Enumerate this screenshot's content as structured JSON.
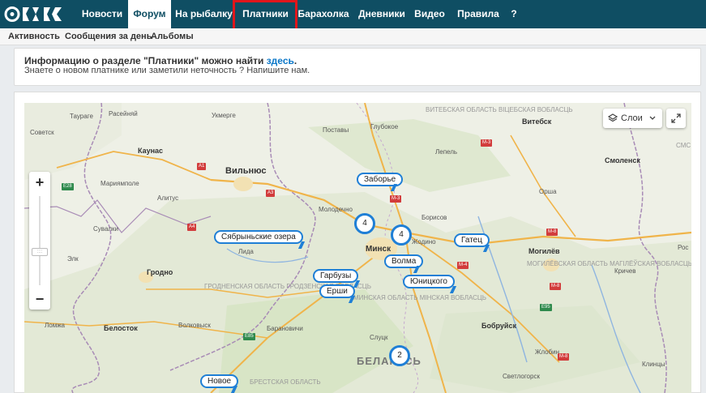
{
  "logo": {
    "name": "site-logo"
  },
  "nav": {
    "items": [
      "Новости",
      "Форум",
      "На рыбалку",
      "Платники",
      "Барахолка",
      "Дневники",
      "Видео",
      "Правила",
      "?"
    ]
  },
  "subnav": {
    "items": [
      "Активность",
      "Сообщения за день",
      "Альбомы"
    ]
  },
  "info": {
    "title_prefix": "Информацию о разделе \"Платники\" можно найти",
    "link": "здесь",
    "title_suffix": ".",
    "subtitle": "Знаете о новом платнике или заметили неточность ? Напишите нам."
  },
  "map": {
    "layers_label": "Слои",
    "zoom_in": "+",
    "zoom_out": "−",
    "places": [
      "Таураге",
      "Расейняй",
      "Укмерге",
      "Поставы",
      "Глубокое",
      "Витебск",
      "Советск",
      "Каунас",
      "Вильнюс",
      "Лепель",
      "Смоленск",
      "Мариямполе",
      "Алитус",
      "Молодечно",
      "Борисов",
      "Орша",
      "Сувалки",
      "Лида",
      "Минск",
      "Жодино",
      "Могилёв",
      "Элк",
      "Гродно",
      "Кричев",
      "Ломжа",
      "Белосток",
      "Волковыск",
      "Барановичи",
      "Слуцк",
      "Бобруйск",
      "Жлобин",
      "Клинцы",
      "Светлогорск",
      "Рос",
      "СМС"
    ],
    "regions": [
      "ВИТЕБСКАЯ ОБЛАСТЬ ВІЦЕБСКАЯ ВОБЛАСЦЬ",
      "МОГИЛЁВСКАЯ ОБЛАСТЬ МАГІЛЁЎСКАЯ ВОБЛАСЦЬ",
      "ГРОДНЕНСКАЯ ОБЛАСТЬ ГРОДЗЕНСКАЯ ВОБЛАСЦЬ",
      "МИНСКАЯ ОБЛАСТЬ МІНСКАЯ ВОБЛАСЦЬ",
      "БРЕСТСКАЯ ОБЛАСТЬ",
      "БЕЛАРУСЬ"
    ],
    "roads": [
      "M-3",
      "A1",
      "A3",
      "E28",
      "A4",
      "M-3",
      "M-8",
      "M-4",
      "M-8",
      "E95",
      "E85",
      "M-8"
    ],
    "markers": [
      "Заборье",
      "Сябрыньские озера",
      "Гатец",
      "Волма",
      "Гарбузы",
      "Юницкого",
      "Ерши",
      "Новое"
    ],
    "clusters": [
      "4",
      "4",
      "2"
    ]
  },
  "colors": {
    "nav_bg": "#0f4e63",
    "marker_border": "#1f7fd6",
    "highlight": "#e0161b"
  }
}
